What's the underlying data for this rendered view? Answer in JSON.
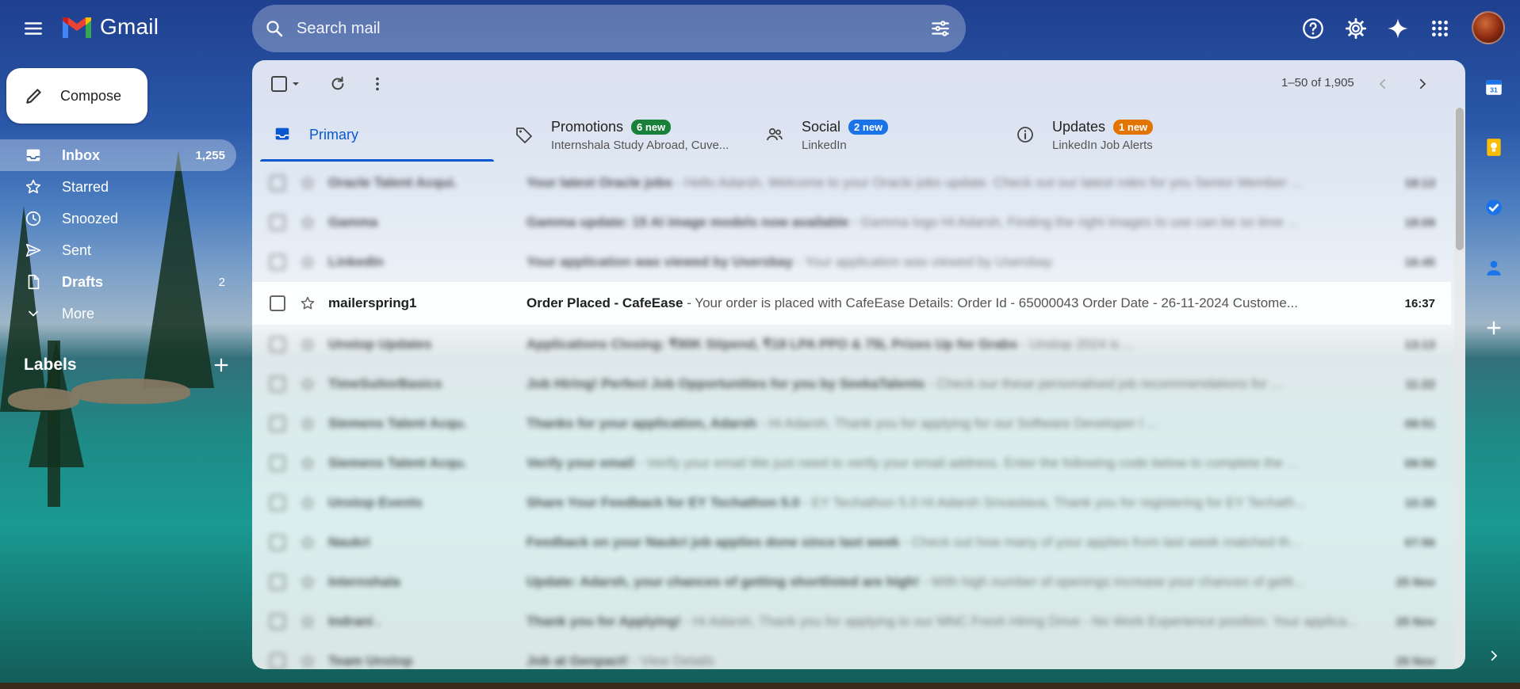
{
  "header": {
    "app_name": "Gmail",
    "search_placeholder": "Search mail"
  },
  "compose": {
    "label": "Compose"
  },
  "nav": [
    {
      "label": "Inbox",
      "count": "1,255",
      "icon": "inbox-icon"
    },
    {
      "label": "Starred",
      "count": "",
      "icon": "star-icon"
    },
    {
      "label": "Snoozed",
      "count": "",
      "icon": "clock-icon"
    },
    {
      "label": "Sent",
      "count": "",
      "icon": "send-icon"
    },
    {
      "label": "Drafts",
      "count": "2",
      "icon": "draft-icon"
    },
    {
      "label": "More",
      "count": "",
      "icon": "chevron-down-icon"
    }
  ],
  "labels_heading": "Labels",
  "pager": {
    "text": "1–50 of 1,905"
  },
  "tabs": [
    {
      "title": "Primary",
      "badge": "",
      "subtitle": "",
      "icon": "inbox-icon"
    },
    {
      "title": "Promotions",
      "badge": "6 new",
      "badge_color": "#188038",
      "subtitle": "Internshala Study Abroad, Cuve...",
      "icon": "tag-icon"
    },
    {
      "title": "Social",
      "badge": "2 new",
      "badge_color": "#1a73e8",
      "subtitle": "LinkedIn",
      "icon": "people-icon"
    },
    {
      "title": "Updates",
      "badge": "1 new",
      "badge_color": "#e37400",
      "subtitle": "LinkedIn Job Alerts",
      "icon": "info-icon"
    }
  ],
  "emails": [
    {
      "sender": "Oracle Talent Acqui.",
      "subject": "Your latest Oracle jobs",
      "snippet": " - Hello Adarsh, Welcome to your Oracle jobs update. Check out our latest roles for you Senior Member ...",
      "time": "18:13"
    },
    {
      "sender": "Gamma",
      "subject": "Gamma update: 15 AI image models now available",
      "snippet": " - Gamma logo Hi Adarsh, Finding the right images to use can be so time ...",
      "time": "18:09"
    },
    {
      "sender": "LinkedIn",
      "subject": "Your application was viewed by Usersbay",
      "snippet": " - Your application was viewed by Usersbay",
      "time": "16:45"
    },
    {
      "sender": "mailerspring1",
      "subject": "Order Placed - CafeEase",
      "snippet": " - Your order is placed with CafeEase Details: Order Id - 65000043 Order Date - 26-11-2024 Custome...",
      "time": "16:37"
    },
    {
      "sender": "Unstop Updates",
      "subject": "Applications Closing: ₹90K Stipend, ₹18 LPA PPO & 75L Prizes Up for Grabs",
      "snippet": " - Unstop 2024 is ...",
      "time": "13:13"
    },
    {
      "sender": "TimeSuitorBasics",
      "subject": "Job Hiring! Perfect Job Opportunities for you by SeekaTalents",
      "snippet": " - Check our these personalised job recommendations for ...",
      "time": "11:22"
    },
    {
      "sender": "Siemens Talent Acqu.",
      "subject": "Thanks for your application, Adarsh",
      "snippet": " - Hi Adarsh, Thank you for applying for our Software Developer I ...",
      "time": "09:51"
    },
    {
      "sender": "Siemens Talent Acqu.",
      "subject": "Verify your email",
      "snippet": " - Verify your email We just need to verify your email address. Enter the following code below to complete the ...",
      "time": "09:50"
    },
    {
      "sender": "Unstop Events",
      "subject": "Share Your Feedback for EY Techathon 5.0",
      "snippet": " - EY Techathon 5.0 Hi Adarsh Srivastava, Thank you for registering for EY Techath...",
      "time": "10:35"
    },
    {
      "sender": "Naukri",
      "subject": "Feedback on your Naukri job applies done since last week",
      "snippet": " - Check out how many of your applies from last week matched th...",
      "time": "07:56"
    },
    {
      "sender": "Internshala",
      "subject": "Update: Adarsh, your chances of getting shortlisted are high!",
      "snippet": " - With high number of openings increase your chances of getti...",
      "time": "25 Nov"
    },
    {
      "sender": "Indrani .",
      "subject": "Thank you for Applying!",
      "snippet": " - Hi Adarsh, Thank you for applying to our MNC Fresh Hiring Drive - No Work Experience position. Your applica...",
      "time": "25 Nov"
    },
    {
      "sender": "Team Unstop",
      "subject": "Job at Genpact!",
      "snippet": " - View Details",
      "time": "25 Nov"
    }
  ],
  "colors": {
    "accent": "#0b57d0",
    "gmail_red": "#ea4335",
    "gmail_blue": "#4285f4",
    "gmail_green": "#34a853",
    "gmail_yellow": "#fbbc04"
  }
}
